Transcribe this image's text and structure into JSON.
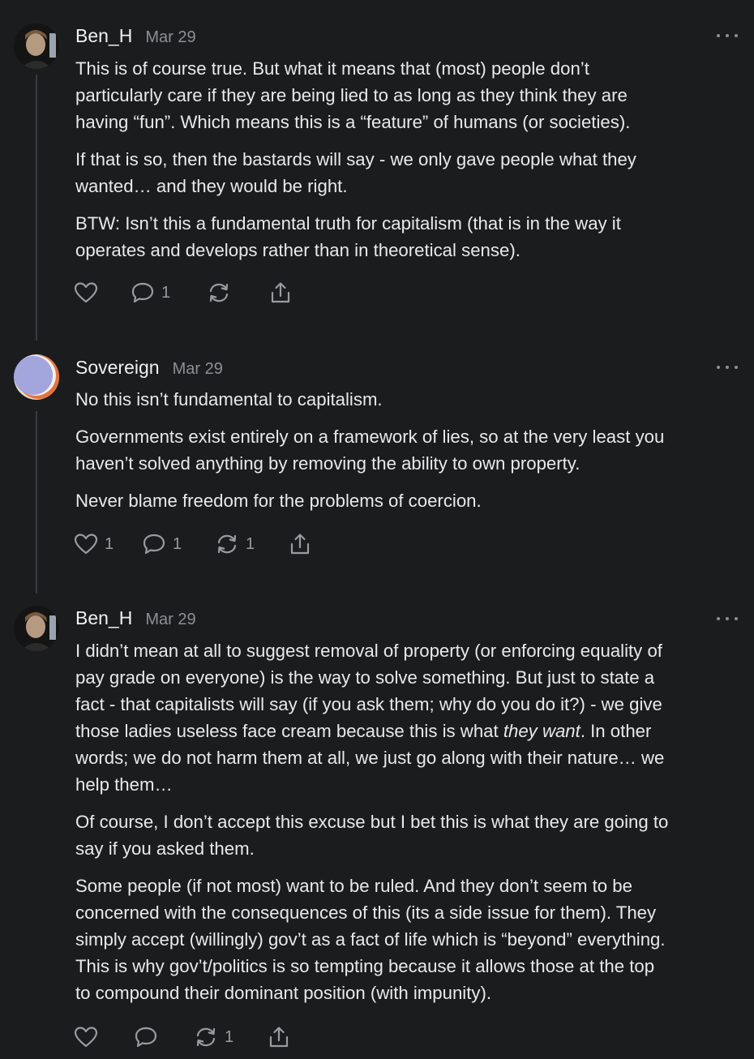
{
  "comments": [
    {
      "author": "Ben_H",
      "date": "Mar 29",
      "avatar_icon": "user-photo-avatar",
      "paragraphs": [
        [
          "This is of course true. But what it means that (most) people don’t",
          "particularly care if they are being lied to as long as they think they are",
          "having “fun”. Which means this is a “feature” of humans (or societies)."
        ],
        [
          "If that is so, then the bastards will say - we only gave people what they",
          "wanted… and they would be right."
        ],
        [
          "BTW: Isn’t this a fundamental truth for capitalism (that is in the way it",
          "operates and develops rather than in theoretical sense)."
        ]
      ],
      "actions": {
        "like_count": "",
        "reply_count": "1",
        "restack_count": ""
      }
    },
    {
      "author": "Sovereign",
      "date": "Mar 29",
      "avatar_icon": "gradient-circle-avatar",
      "paragraphs": [
        [
          "No this isn’t fundamental to capitalism."
        ],
        [
          "Governments exist entirely on a framework of lies, so at the very least you",
          "haven’t solved anything by removing the ability to own property."
        ],
        [
          "Never blame freedom for the problems of coercion."
        ]
      ],
      "actions": {
        "like_count": "1",
        "reply_count": "1",
        "restack_count": "1"
      }
    },
    {
      "author": "Ben_H",
      "date": "Mar 29",
      "avatar_icon": "user-photo-avatar",
      "paragraphs": [
        [
          "I didn’t mean at all to suggest removal of property (or enforcing equality of",
          "pay grade on everyone) is the way to solve something. But just to state a",
          "fact - that capitalists will say (if you ask them; why do you do it?) - we give"
        ],
        [
          "Of course, I don’t accept this excuse but I bet this is what they are going to",
          "say if you asked them."
        ],
        [
          "Some people (if not most) want to be ruled. And they don’t seem to be",
          "concerned with the consequences of this (its a side issue for them). They",
          "simply accept (willingly) gov’t as a fact of life which is “beyond” everything.",
          "This is why gov’t/politics is so tempting because it allows those at the top",
          "to compound their dominant position (with impunity)."
        ]
      ],
      "para1_rich": {
        "before": "those ladies useless face cream because this is what ",
        "emphasis": "they want",
        "after": ". In other"
      },
      "para1_tail": [
        "words; we do not harm them at all, we just go along with their nature… we",
        "help them…"
      ],
      "actions": {
        "like_count": "",
        "reply_count": "",
        "restack_count": "1"
      }
    }
  ]
}
